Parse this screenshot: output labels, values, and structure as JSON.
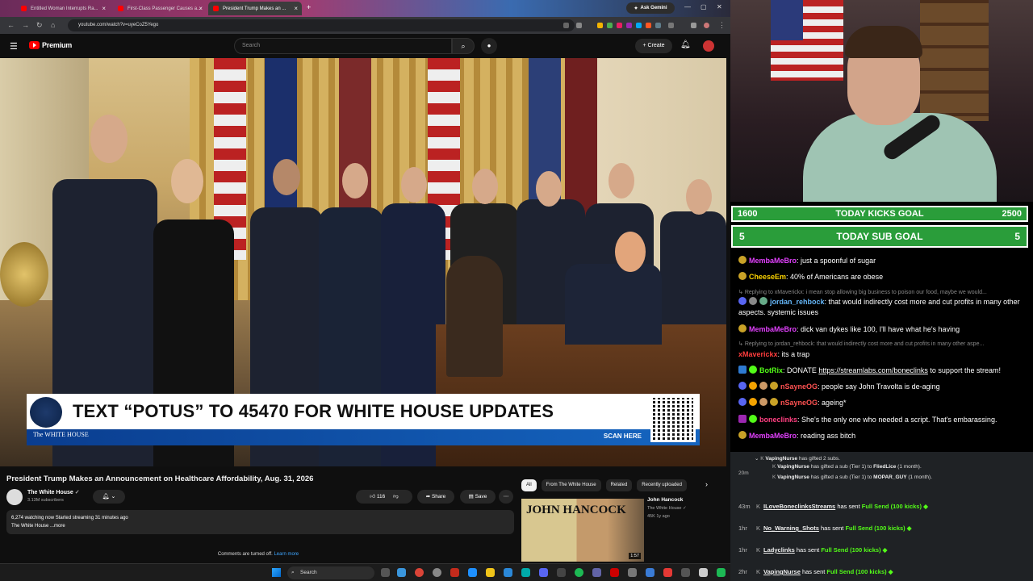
{
  "tabs": [
    {
      "title": "Entitled Woman Interrupts Ra..."
    },
    {
      "title": "First-Class Passenger Causes a..."
    },
    {
      "title": "President Trump Makes an ..."
    }
  ],
  "ask_gemini": "Ask Gemini",
  "url": "youtube.com/watch?v=uyeCoZ5Yego",
  "youtube": {
    "logo_text": "Premium",
    "search_placeholder": "Search",
    "create_label": "Create"
  },
  "lower_third": {
    "headline": "TEXT “POTUS” TO 45470 FOR WHITE HOUSE UPDATES",
    "brand": "The WHITE HOUSE",
    "scan": "SCAN HERE"
  },
  "video_info": {
    "title": "President Trump Makes an Announcement on Healthcare Affordability, Aug. 31, 2026",
    "channel": "The White House",
    "subscribers": "3.13M subscribers",
    "likes": "116",
    "share": "Share",
    "save": "Save",
    "desc_line1": "6,274 watching now  Started streaming 31 minutes ago",
    "desc_line2": "The White House ...more",
    "comments_off": "Comments are turned off.",
    "learn_more": "Learn more"
  },
  "chips": [
    "All",
    "From The White House",
    "Related",
    "Recently uploaded"
  ],
  "recommended": {
    "thumb_title": "JOHN HANCOCK",
    "title": "John Hancock",
    "channel": "The White House",
    "meta": "45K  1y ago",
    "duration": "1:57"
  },
  "goals": {
    "kicks_left": "1600",
    "kicks_label": "TODAY KICKS GOAL",
    "kicks_right": "2500",
    "sub_left": "5",
    "sub_label": "TODAY SUB GOAL",
    "sub_right": "5"
  },
  "chat": [
    {
      "user": "MembaMeBro",
      "color": "#e040fb",
      "text": "just a spoonful of sugar"
    },
    {
      "user": "CheeseEm",
      "color": "#ffd600",
      "text": "40% of Americans are obese"
    },
    {
      "reply": "Replying to xMaverickx: i mean stop allowing big business to poison our food, maybe we would..."
    },
    {
      "user": "jordan_rehbock",
      "color": "#64b5f6",
      "text": "that would indirectly cost more and cut profits in many other aspects. systemic issues"
    },
    {
      "user": "MembaMeBro",
      "color": "#e040fb",
      "text": "dick van dykes like 100, I'll have what he's having"
    },
    {
      "reply": "Replying to jordan_rehbock: that would indirectly cost more and cut profits in many other aspe..."
    },
    {
      "user": "xMaverickx",
      "color": "#ff3d3d",
      "text": "its a trap"
    },
    {
      "user": "BotRix",
      "color": "#53fc18",
      "text": "DONATE ",
      "link": "https://streamlabs.com/boneclinks",
      "after": " to support the stream!"
    },
    {
      "user": "nSayneOG",
      "color": "#ff5252",
      "text": "people say John Travolta is de-aging"
    },
    {
      "user": "nSayneOG",
      "color": "#ff5252",
      "text": "ageing*"
    },
    {
      "user": "boneclinks",
      "color": "#ff4081",
      "text": "She's the only one who needed a script. That's embarassing."
    },
    {
      "user": "MembaMeBro",
      "color": "#e040fb",
      "text": "reading ass bitch"
    }
  ],
  "events": {
    "gift_user": "VapingNurse",
    "gift_text": "has gifted 2 subs.",
    "gift_time": "20m",
    "gift1_text": "has gifted a sub (Tier 1) to",
    "gift1_to": "FliedLice",
    "gift1_dur": "(1 month).",
    "gift2_to": "MOPAR_GUY",
    "rows": [
      {
        "time": "43m",
        "user": "ILoveBoneclinksStreams",
        "mid": "has sent",
        "gift": "Full Send (100 kicks)"
      },
      {
        "time": "1hr",
        "user": "No_Warning_Shots",
        "mid": "has sent",
        "gift": "Full Send (100 kicks)"
      },
      {
        "time": "1hr",
        "user": "Ladyclinks",
        "mid": "has sent",
        "gift": "Full Send (100 kicks)"
      },
      {
        "time": "2hr",
        "user": "VapingNurse",
        "mid": "has sent",
        "gift": "Full Send (100 kicks)"
      }
    ]
  },
  "taskbar": {
    "search": "Search"
  }
}
